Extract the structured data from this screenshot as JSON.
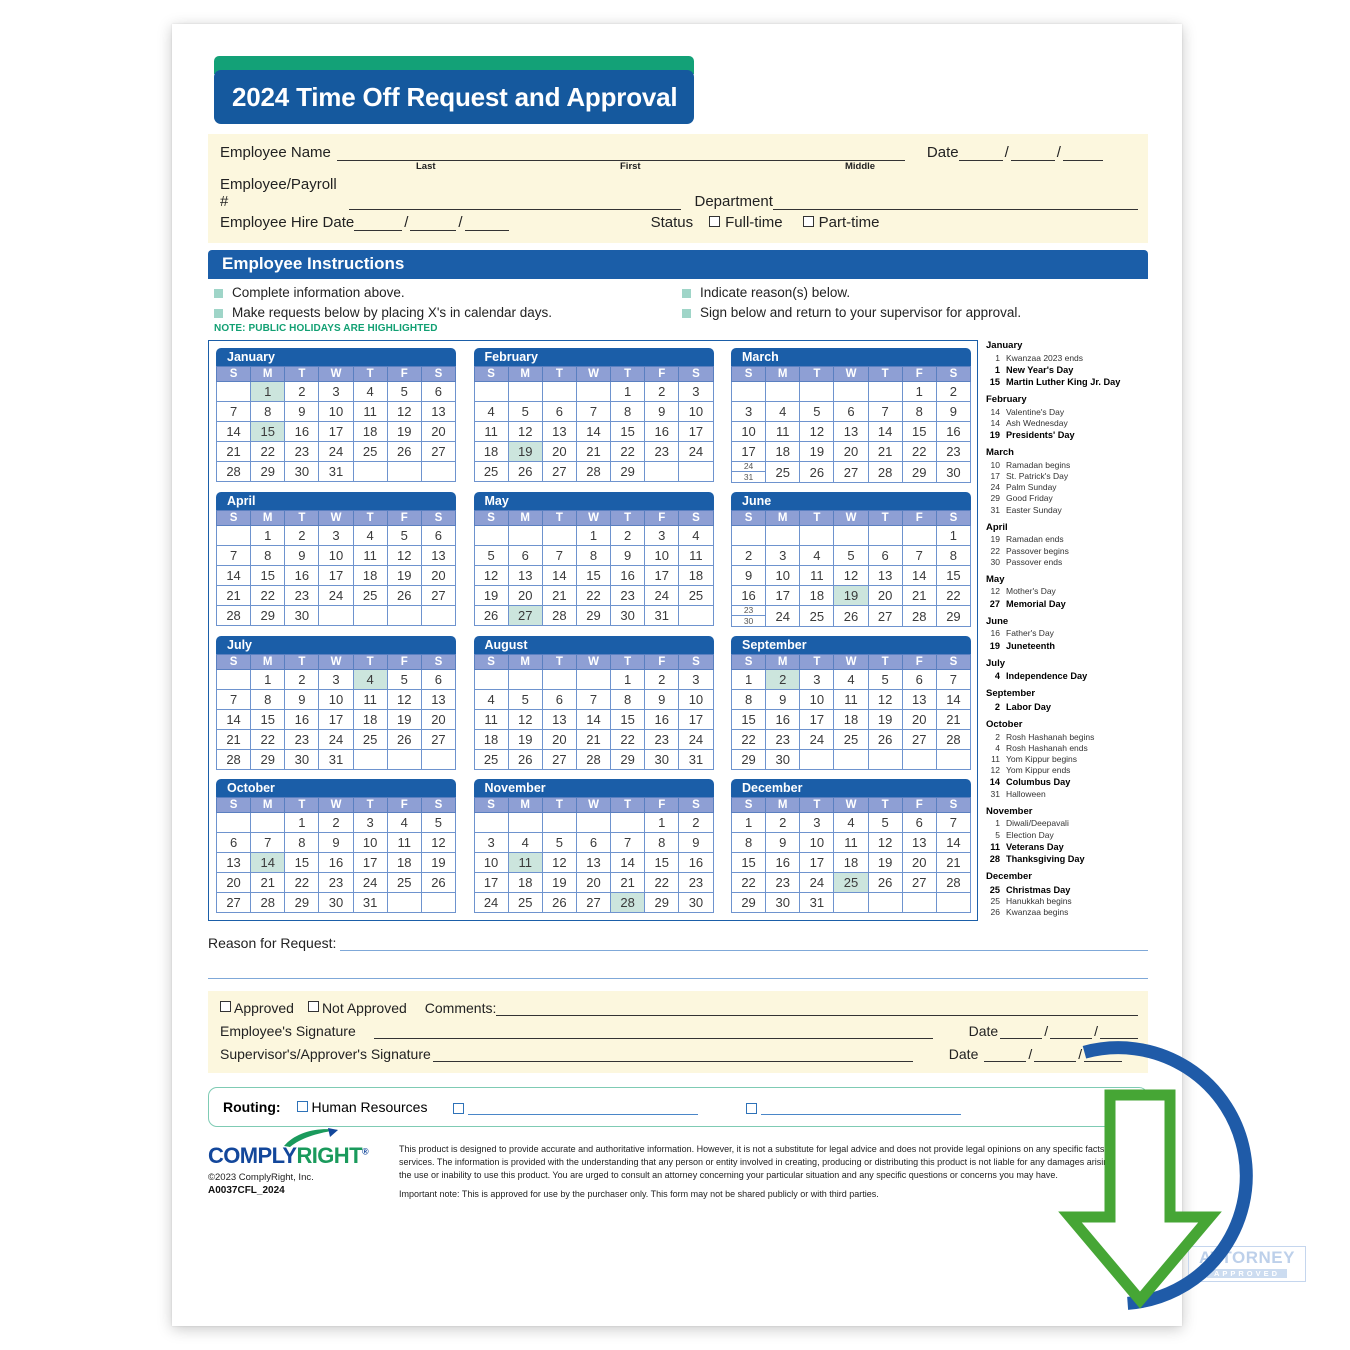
{
  "document": {
    "title": "2024 Time Off Request and Approval",
    "form_code": "A0037CFL_2024",
    "copyright": "©2023 ComplyRight, Inc.",
    "brand": {
      "part1": "COMPLY",
      "part2": "RIGHT",
      "tm": "®"
    },
    "watermark": {
      "line1": "ATTORNEY",
      "line2": "APPROVED"
    },
    "colors": {
      "header_blue": "#15599E",
      "green_cap": "#13A177",
      "cream": "#FCF7DE",
      "highlight": "#CCE5DD",
      "weekday_header": "#8E9FD4",
      "note_green": "#12A073"
    }
  },
  "employee_info": {
    "name_label": "Employee Name",
    "name_value": "",
    "name_placeholder": "",
    "sub_last": "Last",
    "sub_first": "First",
    "sub_middle": "Middle",
    "date_label": "Date",
    "date_value": "",
    "payroll_label": "Employee/Payroll #",
    "payroll_value": "",
    "department_label": "Department",
    "department_value": "",
    "hire_date_label": "Employee Hire Date",
    "hire_date_value": "",
    "status_label": "Status",
    "status_options": [
      "Full-time",
      "Part-time"
    ],
    "slash": "/"
  },
  "instructions": {
    "heading": "Employee Instructions",
    "items_left": [
      "Complete information above.",
      "Make requests below by placing X's in calendar days."
    ],
    "items_right": [
      "Indicate reason(s) below.",
      "Sign below and return to your supervisor for approval."
    ],
    "note": "NOTE: PUBLIC HOLIDAYS ARE HIGHLIGHTED"
  },
  "calendar": {
    "weekdays": [
      "S",
      "M",
      "T",
      "W",
      "T",
      "F",
      "S"
    ],
    "year": 2024,
    "months": [
      {
        "name": "January",
        "start": 1,
        "days": 31,
        "highlights": [
          1,
          15
        ]
      },
      {
        "name": "February",
        "start": 4,
        "days": 29,
        "highlights": [
          19
        ]
      },
      {
        "name": "March",
        "start": 5,
        "days": 31,
        "highlights": []
      },
      {
        "name": "April",
        "start": 1,
        "days": 30,
        "highlights": []
      },
      {
        "name": "May",
        "start": 3,
        "days": 31,
        "highlights": [
          27
        ]
      },
      {
        "name": "June",
        "start": 6,
        "days": 30,
        "highlights": [
          19
        ]
      },
      {
        "name": "July",
        "start": 1,
        "days": 31,
        "highlights": [
          4
        ]
      },
      {
        "name": "August",
        "start": 4,
        "days": 31,
        "highlights": []
      },
      {
        "name": "September",
        "start": 0,
        "days": 30,
        "highlights": [
          2
        ]
      },
      {
        "name": "October",
        "start": 2,
        "days": 31,
        "highlights": [
          14
        ]
      },
      {
        "name": "November",
        "start": 5,
        "days": 30,
        "highlights": [
          11,
          28
        ]
      },
      {
        "name": "December",
        "start": 0,
        "days": 31,
        "highlights": [
          25
        ]
      }
    ]
  },
  "holidays": [
    {
      "month": "January",
      "entries": [
        {
          "day": "1",
          "name": "Kwanzaa 2023 ends",
          "bold": false
        },
        {
          "day": "1",
          "name": "New Year's Day",
          "bold": true
        },
        {
          "day": "15",
          "name": "Martin Luther King Jr. Day",
          "bold": true
        }
      ]
    },
    {
      "month": "February",
      "entries": [
        {
          "day": "14",
          "name": "Valentine's Day",
          "bold": false
        },
        {
          "day": "14",
          "name": "Ash Wednesday",
          "bold": false
        },
        {
          "day": "19",
          "name": "Presidents' Day",
          "bold": true
        }
      ]
    },
    {
      "month": "March",
      "entries": [
        {
          "day": "10",
          "name": "Ramadan begins",
          "bold": false
        },
        {
          "day": "17",
          "name": "St. Patrick's Day",
          "bold": false
        },
        {
          "day": "24",
          "name": "Palm Sunday",
          "bold": false
        },
        {
          "day": "29",
          "name": "Good Friday",
          "bold": false
        },
        {
          "day": "31",
          "name": "Easter Sunday",
          "bold": false
        }
      ]
    },
    {
      "month": "April",
      "entries": [
        {
          "day": "19",
          "name": "Ramadan ends",
          "bold": false
        },
        {
          "day": "22",
          "name": "Passover begins",
          "bold": false
        },
        {
          "day": "30",
          "name": "Passover ends",
          "bold": false
        }
      ]
    },
    {
      "month": "May",
      "entries": [
        {
          "day": "12",
          "name": "Mother's Day",
          "bold": false
        },
        {
          "day": "27",
          "name": "Memorial Day",
          "bold": true
        }
      ]
    },
    {
      "month": "June",
      "entries": [
        {
          "day": "16",
          "name": "Father's Day",
          "bold": false
        },
        {
          "day": "19",
          "name": "Juneteenth",
          "bold": true
        }
      ]
    },
    {
      "month": "July",
      "entries": [
        {
          "day": "4",
          "name": "Independence Day",
          "bold": true
        }
      ]
    },
    {
      "month": "September",
      "entries": [
        {
          "day": "2",
          "name": "Labor Day",
          "bold": true
        }
      ]
    },
    {
      "month": "October",
      "entries": [
        {
          "day": "2",
          "name": "Rosh Hashanah begins",
          "bold": false
        },
        {
          "day": "4",
          "name": "Rosh Hashanah ends",
          "bold": false
        },
        {
          "day": "11",
          "name": "Yom Kippur begins",
          "bold": false
        },
        {
          "day": "12",
          "name": "Yom Kippur ends",
          "bold": false
        },
        {
          "day": "14",
          "name": "Columbus Day",
          "bold": true
        },
        {
          "day": "31",
          "name": "Halloween",
          "bold": false
        }
      ]
    },
    {
      "month": "November",
      "entries": [
        {
          "day": "1",
          "name": "Diwali/Deepavali",
          "bold": false
        },
        {
          "day": "5",
          "name": "Election Day",
          "bold": false
        },
        {
          "day": "11",
          "name": "Veterans Day",
          "bold": true
        },
        {
          "day": "28",
          "name": "Thanksgiving Day",
          "bold": true
        }
      ]
    },
    {
      "month": "December",
      "entries": [
        {
          "day": "25",
          "name": "Christmas Day",
          "bold": true
        },
        {
          "day": "25",
          "name": "Hanukkah begins",
          "bold": false
        },
        {
          "day": "26",
          "name": "Kwanzaa begins",
          "bold": false
        }
      ]
    }
  ],
  "reason": {
    "label": "Reason for Request:",
    "value": ""
  },
  "approval": {
    "approved_label": "Approved",
    "not_approved_label": "Not Approved",
    "comments_label": "Comments:",
    "comments_value": "",
    "employee_signature_label": "Employee's Signature",
    "employee_signature_value": "",
    "supervisor_signature_label": "Supervisor's/Approver's Signature",
    "supervisor_signature_value": "",
    "date_label": "Date",
    "employee_date_value": "",
    "supervisor_date_value": "",
    "slash": "/"
  },
  "routing": {
    "label": "Routing:",
    "hr_option": "Human Resources",
    "blank1_value": "",
    "blank2_value": ""
  },
  "legal": {
    "paragraph1": "This product is designed to provide accurate and authoritative information. However, it is not a substitute for legal advice and does not provide legal opinions on any specific facts or services. The information is provided with the understanding that any person or entity involved in creating, producing or distributing this product is not liable for any damages arising out of the use or inability to use this product. You are urged to consult an attorney concerning your particular situation and any specific questions or concerns you may have.",
    "paragraph2": "Important note: This is approved for use by the purchaser only. This form may not be shared publicly or with third parties."
  },
  "overlay": {
    "icon": "download-icon"
  }
}
